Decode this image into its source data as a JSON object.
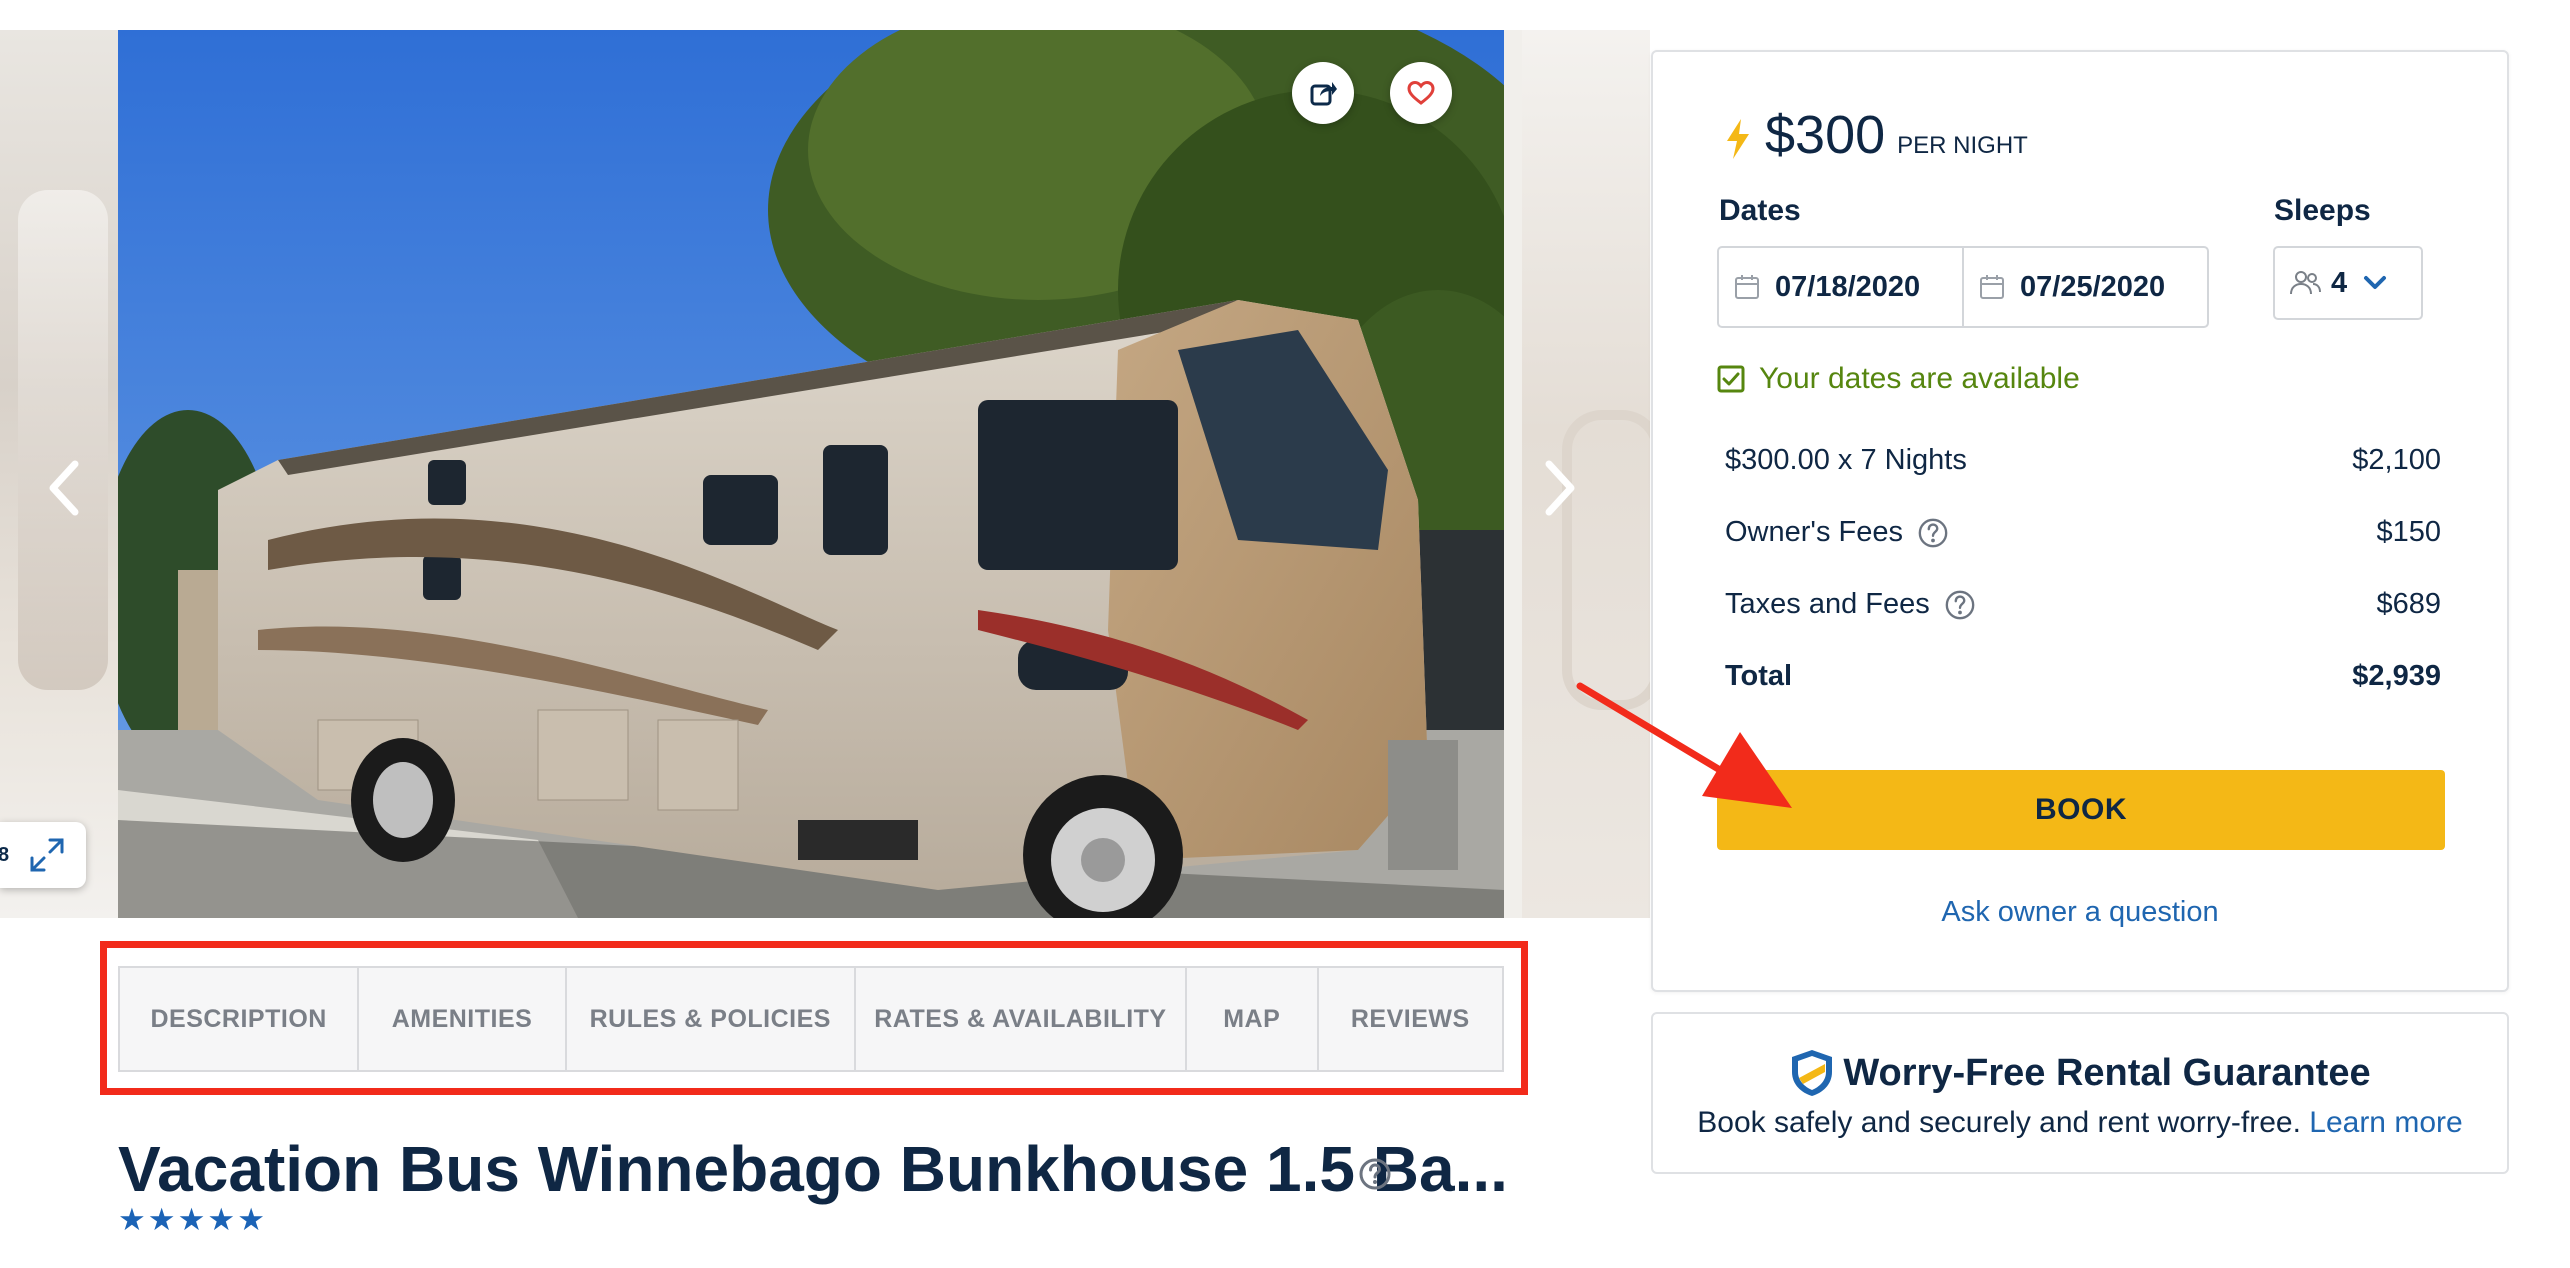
{
  "gallery": {
    "photo_count_fragment": "8",
    "share_icon": "share-icon",
    "favorite_icon": "heart-icon",
    "prev_icon": "chevron-left-icon",
    "next_icon": "chevron-right-icon",
    "expand_icon": "expand-icon"
  },
  "tabs": [
    {
      "label": "DESCRIPTION"
    },
    {
      "label": "AMENITIES"
    },
    {
      "label": "RULES & POLICIES"
    },
    {
      "label": "RATES & AVAILABILITY"
    },
    {
      "label": "MAP"
    },
    {
      "label": "REVIEWS"
    }
  ],
  "listing": {
    "title": "Vacation Bus Winnebago Bunkhouse 1.5 Ba...",
    "rating_stars": 5
  },
  "booking": {
    "price": "$300",
    "per_night": "PER NIGHT",
    "dates_label": "Dates",
    "sleeps_label": "Sleeps",
    "check_in": "07/18/2020",
    "check_out": "07/25/2020",
    "sleeps_value": "4",
    "availability_text": "Your dates are available",
    "line_items": [
      {
        "label": "$300.00 x 7 Nights",
        "amount": "$2,100"
      },
      {
        "label": "Owner's Fees",
        "amount": "$150"
      },
      {
        "label": "Taxes and Fees",
        "amount": "$689"
      }
    ],
    "total_label": "Total",
    "total_amount": "$2,939",
    "book_label": "BOOK",
    "ask_label": "Ask owner a question"
  },
  "guarantee": {
    "title": "Worry-Free Rental Guarantee",
    "body": "Book safely and securely and rent worry-free.",
    "link": "Learn more"
  },
  "colors": {
    "accent_yellow": "#f4b816",
    "navy": "#0f2744",
    "link_blue": "#1f66b0",
    "available_green": "#56860f",
    "annotation_red": "#f22b1b"
  }
}
